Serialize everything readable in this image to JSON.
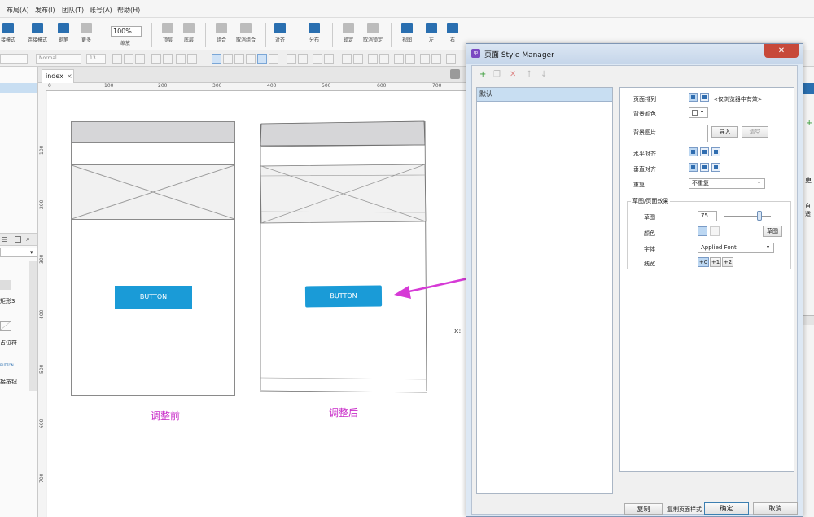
{
  "menu": [
    "布局(A)",
    "发布(I)",
    "团队(T)",
    "账号(A)",
    "帮助(H)"
  ],
  "toolbar": {
    "items": [
      "接模式",
      "连接模式",
      "钢笔",
      "更多",
      "缩放",
      "顶层",
      "底层",
      "组合",
      "取消组合",
      "对齐",
      "分布",
      "锁定",
      "取消锁定",
      "视图",
      "左",
      "右"
    ],
    "zoom": "100%"
  },
  "format_bar": {
    "style": "Normal",
    "size": "13"
  },
  "canvas": {
    "tab": "index",
    "hruler": [
      "0",
      "100",
      "200",
      "300",
      "400",
      "500",
      "600",
      "700"
    ],
    "vruler": [
      "100",
      "200",
      "300",
      "400",
      "500",
      "600",
      "700"
    ],
    "before_button": "BUTTON",
    "after_button": "BUTTON",
    "caption_before": "调整前",
    "caption_after": "调整后",
    "x_label": "x:"
  },
  "left_panel": {
    "item1": "矩形3",
    "item2": "占位符",
    "item3": "BUTTON",
    "item4": "接按钮"
  },
  "right_dock": {
    "item1": "更",
    "item2": "自适"
  },
  "dialog": {
    "title": "页面 Style Manager",
    "close": "✕",
    "style_list": [
      "默认"
    ],
    "props": {
      "page_align_label": "页面排列",
      "page_align_note": "<仅浏览器中有效>",
      "bg_color_label": "背景颜色",
      "bg_image_label": "背景图片",
      "import_btn": "导入",
      "clear_btn": "清空",
      "h_align_label": "水平对齐",
      "v_align_label": "垂直对齐",
      "repeat_label": "重复",
      "repeat_value": "不重复",
      "group_title": "草图/页面效果",
      "sketch_label": "草图",
      "sketch_value": "75",
      "sketch_fraction": 0.75,
      "color_label": "颜色",
      "sketch_btn": "草图",
      "font_label": "字体",
      "font_value": "Applied Font",
      "line_label": "线宽",
      "line_options": [
        "+0",
        "+1",
        "+2"
      ]
    },
    "copy_btn": "复制",
    "copy_note": "复制页面样式",
    "ok_btn": "确定",
    "cancel_btn": "取消"
  },
  "colors": {
    "accent_button": "#1a9bd7",
    "annotation": "#c82bc8"
  }
}
